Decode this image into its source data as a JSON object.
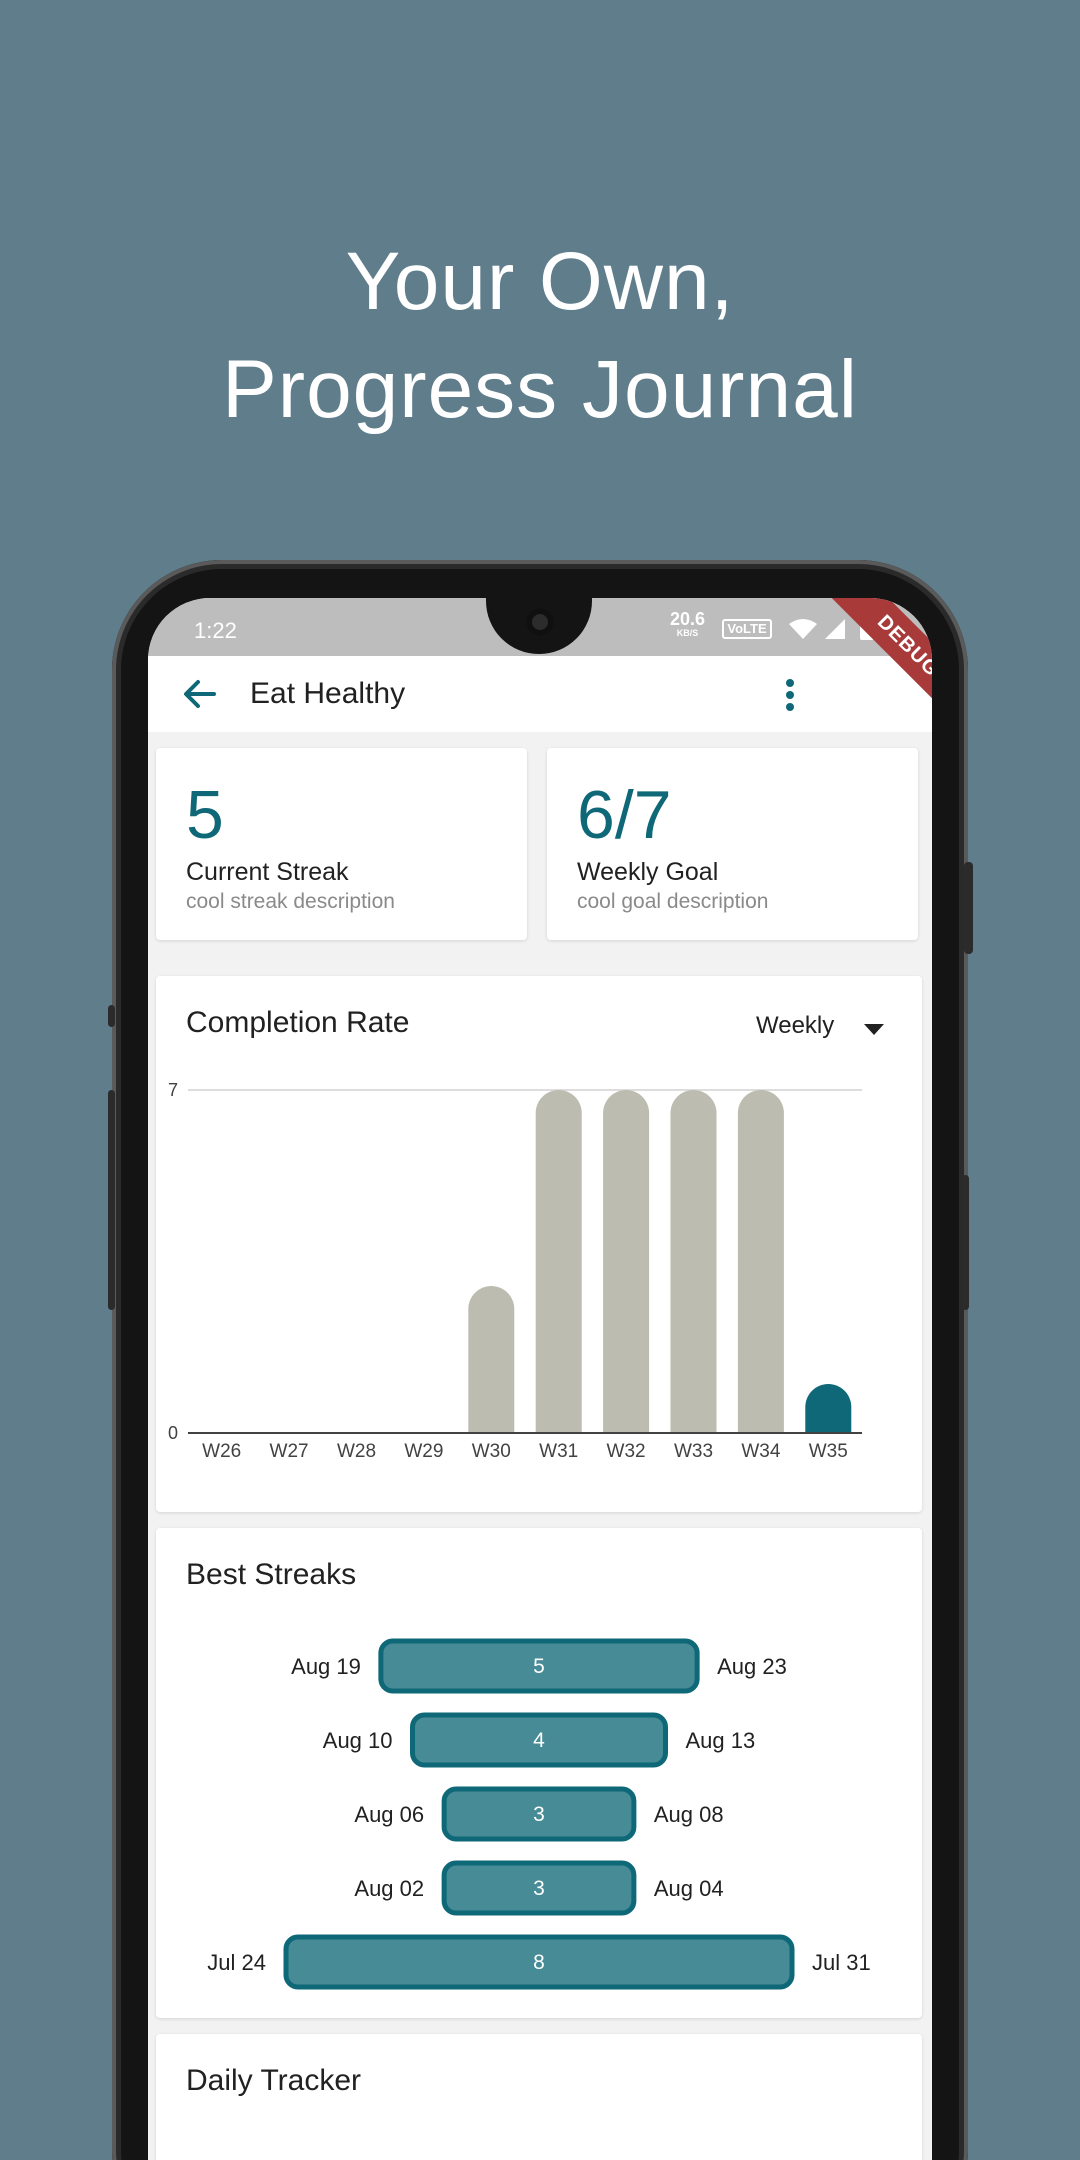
{
  "promo": {
    "line1": "Your Own,",
    "line2": "Progress Journal"
  },
  "status_bar": {
    "time": "1:22",
    "speed": "20.6",
    "speed_unit": "KB/S",
    "network": "VoLTE"
  },
  "debug_banner": "DEBUG",
  "app_bar": {
    "title": "Eat Healthy"
  },
  "stats": {
    "streak": {
      "value": "5",
      "label": "Current Streak",
      "description": "cool streak description"
    },
    "goal": {
      "value": "6/7",
      "label": "Weekly Goal",
      "description": "cool goal description"
    }
  },
  "completion": {
    "title": "Completion Rate",
    "period": "Weekly"
  },
  "chart_data": {
    "type": "bar",
    "title": "Completion Rate",
    "categories": [
      "W26",
      "W27",
      "W28",
      "W29",
      "W30",
      "W31",
      "W32",
      "W33",
      "W34",
      "W35"
    ],
    "values": [
      0,
      0,
      0,
      0,
      3,
      7,
      7,
      7,
      7,
      1
    ],
    "highlight_index": 9,
    "y_ticks": [
      0,
      7
    ],
    "ylim": [
      0,
      7
    ],
    "colors": {
      "bar": "#bcbcb0",
      "highlight": "#0e6877",
      "gridline": "#dddddd",
      "axis": "#424242"
    }
  },
  "best_streaks": {
    "title": "Best Streaks",
    "items": [
      {
        "start": "Aug 19",
        "end": "Aug 23",
        "length": "5"
      },
      {
        "start": "Aug 10",
        "end": "Aug 13",
        "length": "4"
      },
      {
        "start": "Aug 06",
        "end": "Aug 08",
        "length": "3"
      },
      {
        "start": "Aug 02",
        "end": "Aug 04",
        "length": "3"
      },
      {
        "start": "Jul 24",
        "end": "Jul 31",
        "length": "8"
      }
    ],
    "colors": {
      "fill": "#468b95",
      "border": "#0e6877"
    }
  },
  "daily_tracker": {
    "title": "Daily Tracker"
  }
}
